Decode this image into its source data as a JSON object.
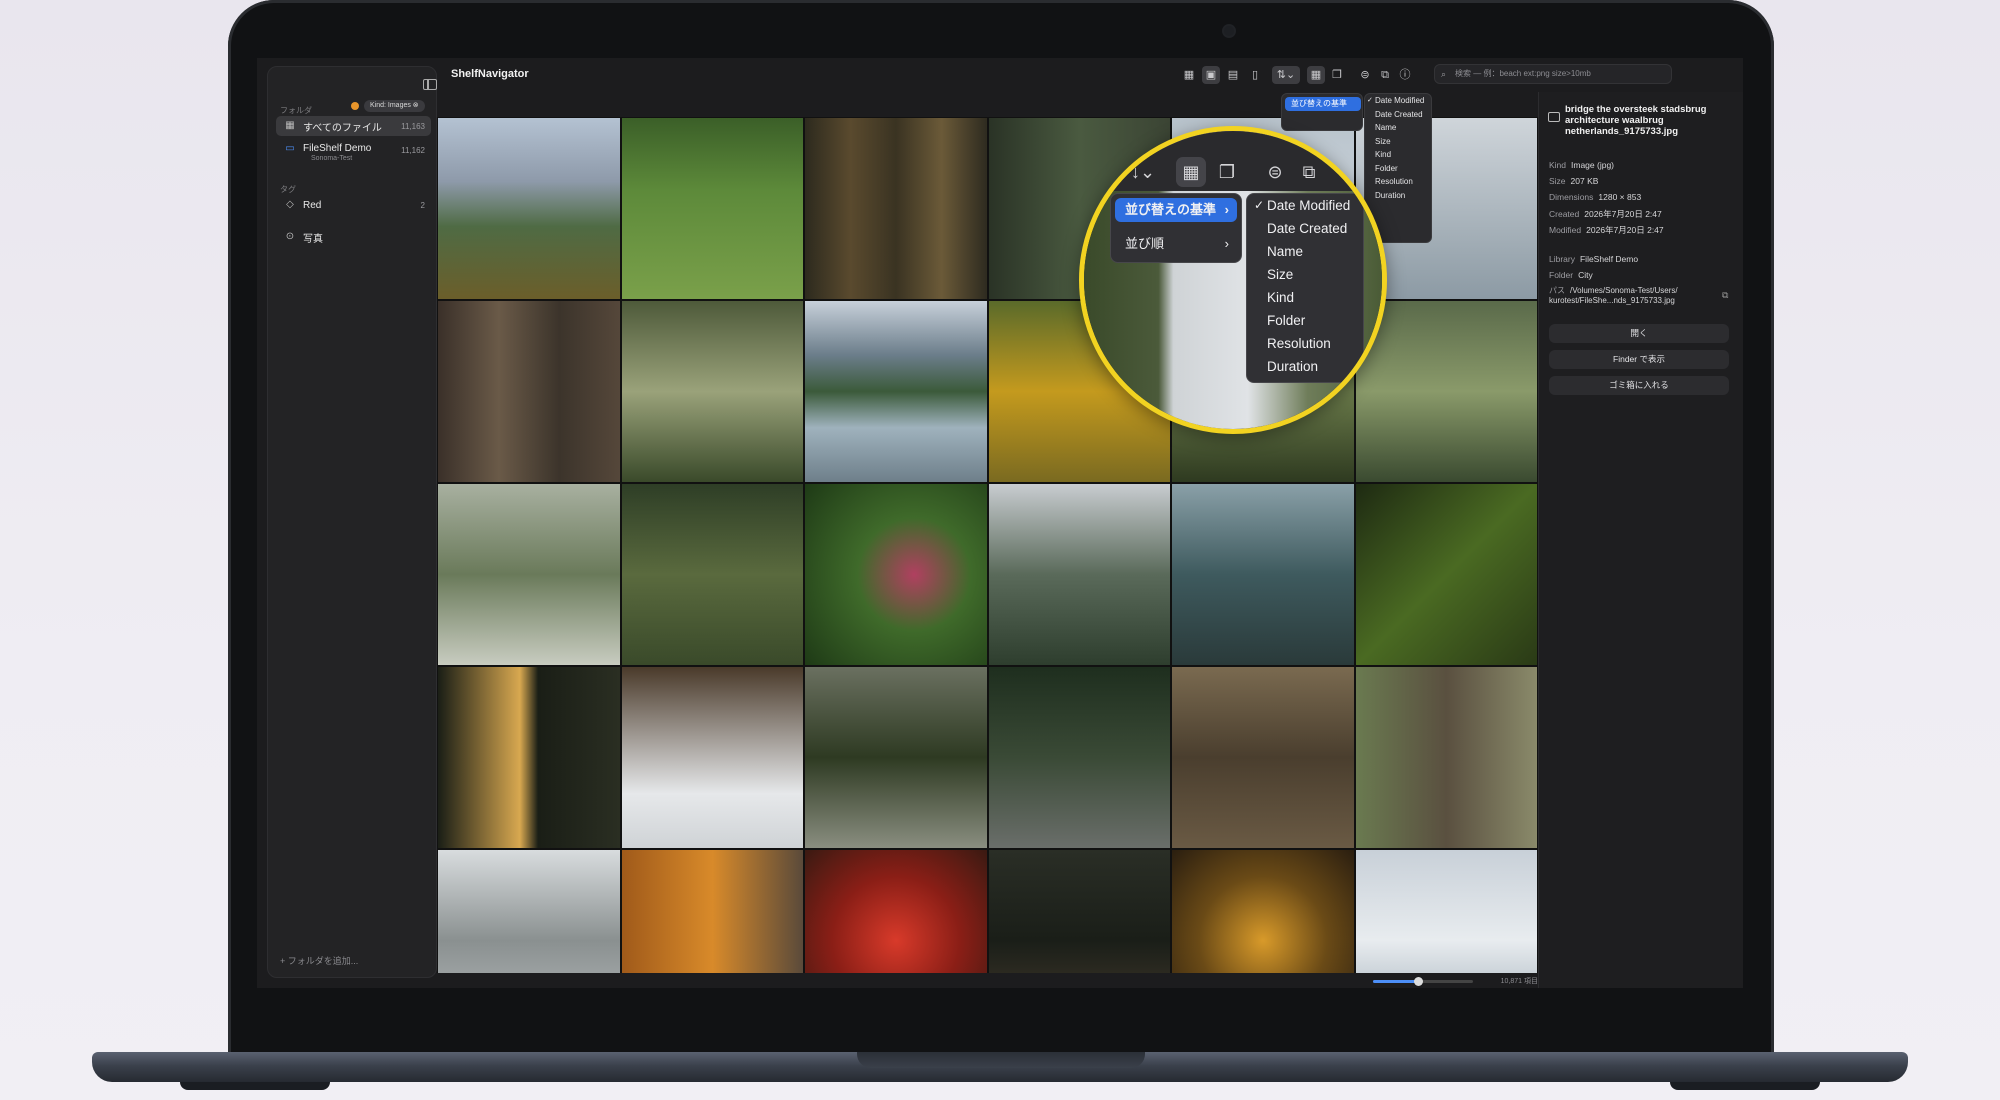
{
  "app": {
    "title": "ShelfNavigator"
  },
  "sidebar": {
    "section_folders": "フォルダ",
    "items": [
      {
        "label": "すべてのファイル",
        "count": "11,163"
      },
      {
        "label": "FileShelf Demo",
        "sub": "Sonoma-Test",
        "count": "11,162"
      }
    ],
    "section_tags": "タグ",
    "tags": [
      {
        "label": "Red",
        "count": "2"
      },
      {
        "label": "写真",
        "count": ""
      }
    ],
    "add_folder": "+ フォルダを追加..."
  },
  "toolbar": {
    "search_placeholder": "検索 — 例：beach ext:png size>10mb"
  },
  "filter": {
    "chip": "Kind: Images ⊗"
  },
  "sort_menu": {
    "sort_by": "並び替えの基準",
    "order": "並び順",
    "options": [
      "Date Modified",
      "Date Created",
      "Name",
      "Size",
      "Kind",
      "Folder",
      "Resolution",
      "Duration"
    ],
    "selected": "Date Modified"
  },
  "status": {
    "count": "10,871 項目",
    "zoom": 0.45
  },
  "inspector": {
    "title": "bridge the oversteek stadsbrug architecture waalbrug netherlands_9175733.jpg",
    "kind_label": "Kind",
    "kind": "Image (jpg)",
    "size_label": "Size",
    "size": "207 KB",
    "dimensions_label": "Dimensions",
    "dimensions": "1280 × 853",
    "created_label": "Created",
    "created": "2026年7月20日 2:47",
    "modified_label": "Modified",
    "modified": "2026年7月20日 2:47",
    "library_label": "Library",
    "library": "FileShelf Demo",
    "folder_label": "Folder",
    "folder": "City",
    "path_label": "パス",
    "path": "/Volumes/Sonoma-Test/Users/ kurotest/FileShe...nds_9175733.jpg",
    "open_btn": "開く",
    "finder_btn": "Finder で表示",
    "trash_btn": "ゴミ箱に入れる"
  },
  "colors": {
    "accent": "#2f6fe0",
    "highlight_ring": "#f2d321"
  }
}
